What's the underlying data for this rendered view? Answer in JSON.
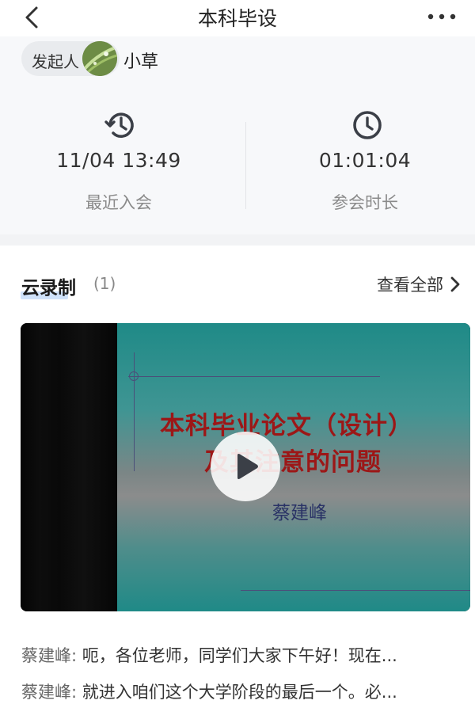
{
  "nav": {
    "title": "本科毕设",
    "back_icon": "chevron-left-icon",
    "more_icon": "more-horizontal-icon"
  },
  "host": {
    "tag": "发起人",
    "name": "小草",
    "avatar_icon": "avatar-image"
  },
  "stats": [
    {
      "value": "11/04 13:49",
      "label": "最近入会",
      "icon": "history-icon"
    },
    {
      "value": "01:01:04",
      "label": "参会时长",
      "icon": "clock-icon"
    }
  ],
  "recordings": {
    "title": "云录制",
    "count": "(1)",
    "view_all": "查看全部",
    "chevron_icon": "chevron-right-icon"
  },
  "video": {
    "slide_title_line1": "本科毕业论文（设计）",
    "slide_title_line2": "及其注意的问题",
    "slide_author": "蔡建峰",
    "play_icon": "play-icon",
    "colors": {
      "slide_teal": "#1f8a87",
      "slide_title_red": "#9c1717"
    }
  },
  "transcript": [
    {
      "speaker": "蔡建峰:",
      "text": "呃，各位老师，同学们大家下午好！现在..."
    },
    {
      "speaker": "蔡建峰:",
      "text": "就进入咱们这个大学阶段的最后一个。必..."
    }
  ]
}
